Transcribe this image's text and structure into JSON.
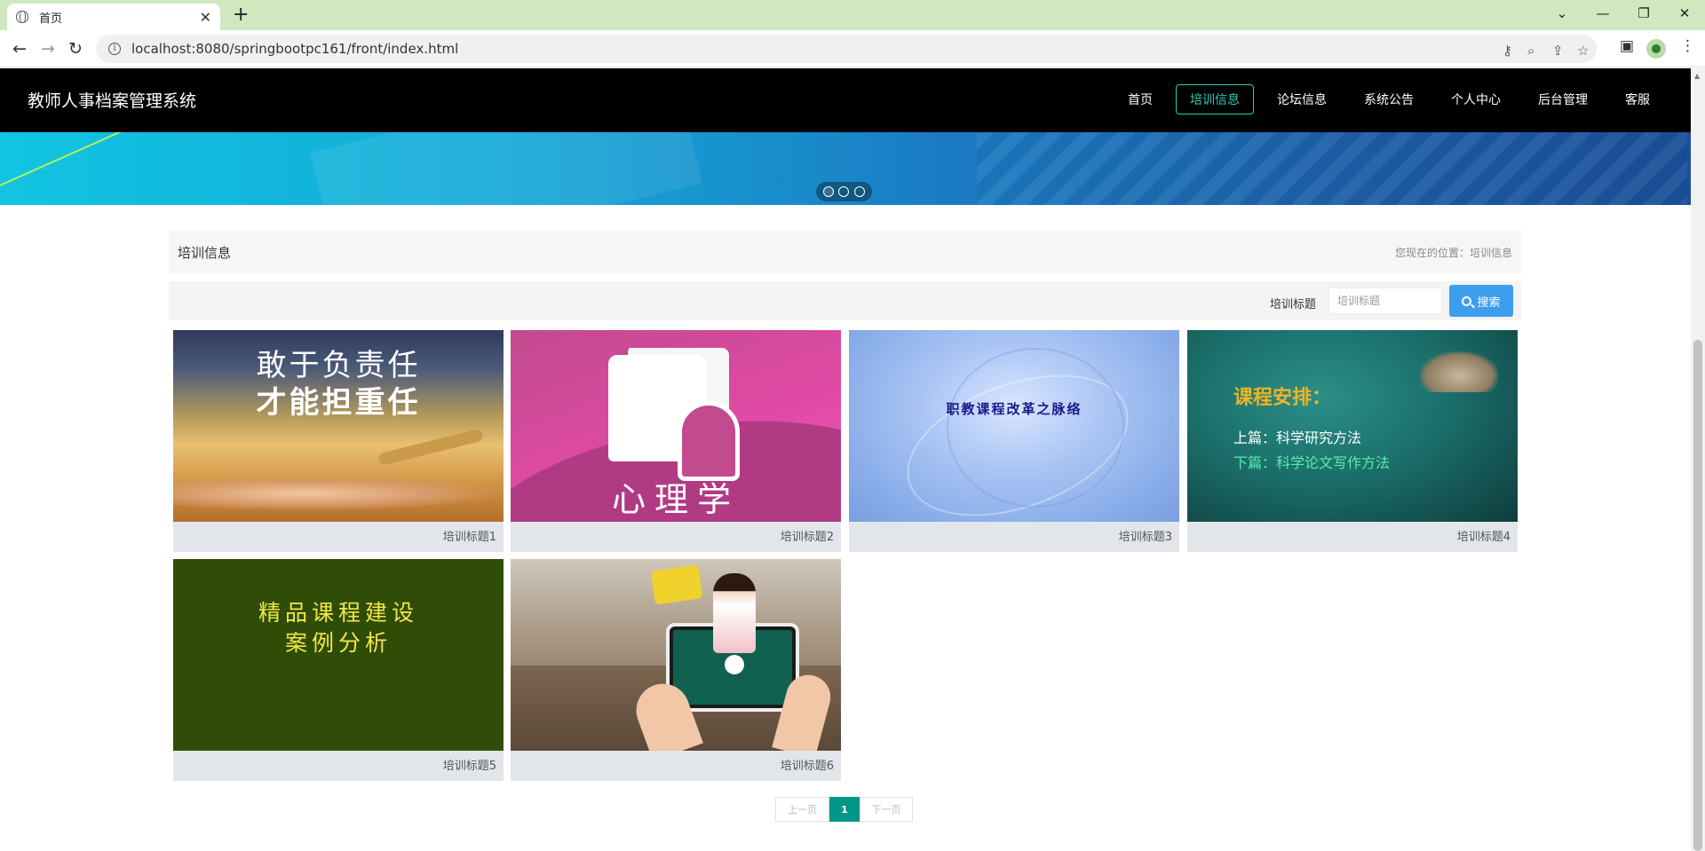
{
  "browser": {
    "tab_title": "首页",
    "tab_close": "✕",
    "new_tab": "+",
    "url": "localhost:8080/springbootpc161/front/index.html"
  },
  "site": {
    "title": "教师人事档案管理系统",
    "nav": [
      {
        "label": "首页",
        "active": false
      },
      {
        "label": "培训信息",
        "active": true
      },
      {
        "label": "论坛信息",
        "active": false
      },
      {
        "label": "系统公告",
        "active": false
      },
      {
        "label": "个人中心",
        "active": false
      },
      {
        "label": "后台管理",
        "active": false
      },
      {
        "label": "客服",
        "active": false
      }
    ]
  },
  "banner": {
    "slide_count": 3,
    "active_slide": 1
  },
  "breadcrumb": {
    "title": "培训信息",
    "location_prefix": "您现在的位置：",
    "location_current": "培训信息"
  },
  "search": {
    "label": "培训标题",
    "placeholder": "培训标题",
    "value": "",
    "button_label": "搜索"
  },
  "cards": [
    {
      "caption": "培训标题1",
      "image_text": [
        "敢于负责任",
        "才能担重任"
      ]
    },
    {
      "caption": "培训标题2",
      "image_text": [
        "心理学"
      ]
    },
    {
      "caption": "培训标题3",
      "image_text": [
        "职教课程改革之脉络"
      ]
    },
    {
      "caption": "培训标题4",
      "image_text": [
        "课程安排：",
        "上篇：科学研究方法",
        "下篇：科学论文写作方法"
      ]
    },
    {
      "caption": "培训标题5",
      "image_text": [
        "精品课程建设",
        "案例分析"
      ]
    },
    {
      "caption": "培训标题6",
      "image_text": []
    }
  ],
  "pagination": {
    "prev_label": "上一页",
    "current_page": "1",
    "next_label": "下一页"
  },
  "colors": {
    "nav_bg": "#000000",
    "nav_active": "#2ecbb7",
    "search_button": "#3d9eef",
    "page_active": "#009688"
  }
}
